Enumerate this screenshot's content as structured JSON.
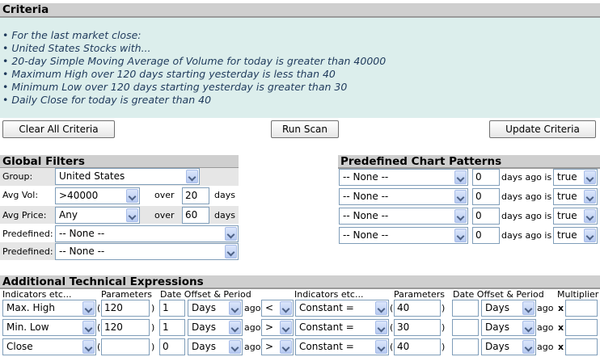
{
  "criteria": {
    "title": "Criteria",
    "items": [
      "• For the last market close:",
      "• United States Stocks with...",
      "• 20-day Simple Moving Average of Volume for today is greater than 40000",
      "• Maximum High over 120 days starting yesterday is less than 40",
      "• Minimum Low over 120 days starting yesterday is greater than 30",
      "• Daily Close for today is greater than 40"
    ],
    "buttons": {
      "clear": "Clear All Criteria",
      "run": "Run Scan",
      "update": "Update Criteria"
    }
  },
  "global_filters": {
    "title": "Global Filters",
    "group_label": "Group:",
    "group_value": "United States",
    "avgvol_label": "Avg Vol:",
    "avgvol_value": ">40000",
    "avgvol_over": "over",
    "avgvol_days": "20",
    "avgvol_unit": "days",
    "avgprice_label": "Avg Price:",
    "avgprice_value": "Any",
    "avgprice_over": "over",
    "avgprice_days": "60",
    "avgprice_unit": "days",
    "predefined_label": "Predefined:",
    "predefined1_value": "-- None --",
    "predefined2_value": "-- None --"
  },
  "chart_patterns": {
    "title": "Predefined Chart Patterns",
    "rows": [
      {
        "pattern": "-- None --",
        "days": "0",
        "ago_text": "days ago is",
        "flag": "true"
      },
      {
        "pattern": "-- None --",
        "days": "0",
        "ago_text": "days ago is",
        "flag": "true"
      },
      {
        "pattern": "-- None --",
        "days": "0",
        "ago_text": "days ago is",
        "flag": "true"
      },
      {
        "pattern": "-- None --",
        "days": "0",
        "ago_text": "days ago is",
        "flag": "true"
      }
    ]
  },
  "technical": {
    "title": "Additional Technical Expressions",
    "headers": {
      "indicators1": "Indicators etc...",
      "parameters1": "Parameters",
      "offset1": "Date Offset & Period",
      "indicators2": "Indicators etc...",
      "parameters2": "Parameters",
      "offset2": "Date Offset & Period",
      "multiplier": "Multiplier"
    },
    "rows": [
      {
        "ind1": "Max. High",
        "param1": "120",
        "offset1": "1",
        "period1": "Days",
        "ago": "ago",
        "op": "<",
        "ind2": "Constant =",
        "param2": "40",
        "offset2": "",
        "period2": "Days",
        "ago2": "ago",
        "mult": ""
      },
      {
        "ind1": "Min. Low",
        "param1": "120",
        "offset1": "1",
        "period1": "Days",
        "ago": "ago",
        "op": ">",
        "ind2": "Constant =",
        "param2": "30",
        "offset2": "",
        "period2": "Days",
        "ago2": "ago",
        "mult": ""
      },
      {
        "ind1": "Close",
        "param1": "",
        "offset1": "0",
        "period1": "Days",
        "ago": "ago",
        "op": ">",
        "ind2": "Constant =",
        "param2": "40",
        "offset2": "",
        "period2": "Days",
        "ago2": "ago",
        "mult": ""
      }
    ],
    "paren_open": "(",
    "paren_close": ")",
    "times": "x"
  }
}
